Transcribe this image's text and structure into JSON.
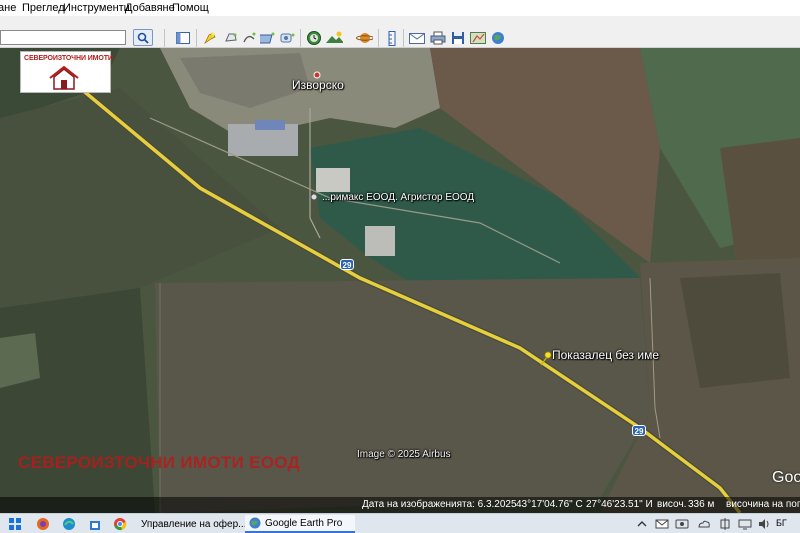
{
  "menubar": {
    "app_partial": "ане",
    "items": [
      "Преглед",
      "Инструменти",
      "Добавяне",
      "Помощ"
    ]
  },
  "toolbar": {
    "search_value": "",
    "icons": [
      "search-icon",
      "sidebar-icon",
      "placemark-icon",
      "polygon-icon",
      "path-icon",
      "image-overlay-icon",
      "tour-icon",
      "history-icon",
      "sunlight-icon",
      "planets-icon",
      "ruler-icon",
      "email-icon",
      "print-icon",
      "save-image-icon",
      "map-icon",
      "web-icon"
    ]
  },
  "map": {
    "logo_text": "СЕВЕРОИЗТОЧНИ ИМОТИ",
    "town_label": "Изворско",
    "company_label": "...римакс ЕООД. Агристор ЕООД",
    "placemark_label": "Показалец без име",
    "road_number_1": "29",
    "road_number_2": "29",
    "credit": "Image © 2025 Airbus",
    "watermark": "СЕВЕРОИЗТОЧНИ ИМОТИ ЕООД",
    "brand_partial": "Goo",
    "colors": {
      "road": "#e6cf3c",
      "placemark": "#f2e12a",
      "watermark": "#b81a1a"
    }
  },
  "statusbar": {
    "imagery_date": "Дата на изображенията: 6.3.2025",
    "lat": "43°17'04.76\" С",
    "lon": "27°46'23.51\" И",
    "elevation_label": "височ.",
    "elevation_value": "336 м",
    "eye_alt": "височина на погле"
  },
  "taskbar": {
    "tasks": [
      {
        "label": "Управление на офер...",
        "icon": "browser-tab-icon"
      },
      {
        "label": "Google Earth Pro",
        "icon": "google-earth-icon"
      }
    ],
    "lang": "БГ"
  }
}
